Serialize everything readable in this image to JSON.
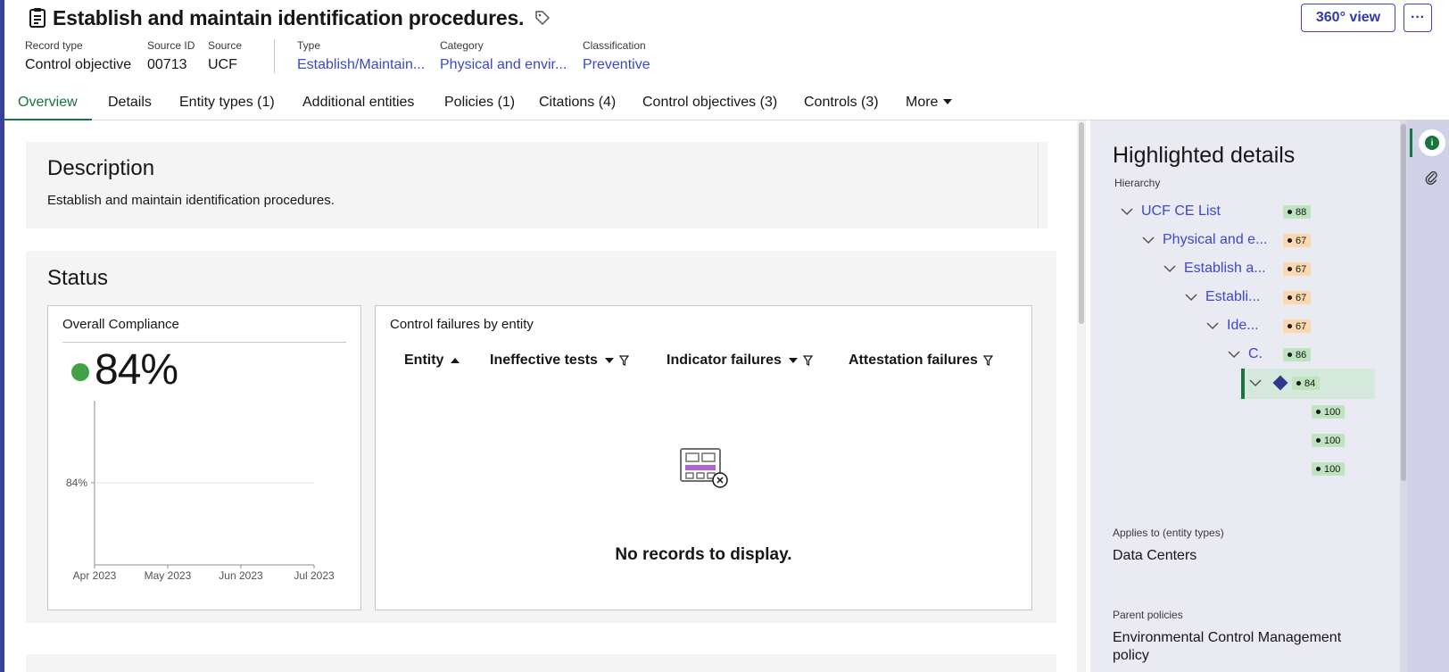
{
  "header": {
    "title": "Establish and maintain identification procedures.",
    "view_360_label": "360° view",
    "overflow_label": "···"
  },
  "meta": {
    "record_type_label": "Record type",
    "record_type_value": "Control objective",
    "source_id_label": "Source ID",
    "source_id_value": "00713",
    "source_label": "Source",
    "source_value": "UCF",
    "type_label": "Type",
    "type_value": "Establish/Maintain...",
    "category_label": "Category",
    "category_value": "Physical and envir...",
    "classification_label": "Classification",
    "classification_value": "Preventive"
  },
  "tabs": [
    {
      "label": "Overview",
      "active": true
    },
    {
      "label": "Details"
    },
    {
      "label": "Entity types (1)"
    },
    {
      "label": "Additional entities"
    },
    {
      "label": "Policies (1)"
    },
    {
      "label": "Citations (4)"
    },
    {
      "label": "Control objectives (3)"
    },
    {
      "label": "Controls (3)"
    },
    {
      "label": "More"
    }
  ],
  "description": {
    "title": "Description",
    "text": "Establish and maintain identification procedures."
  },
  "status": {
    "title": "Status",
    "compliance": {
      "title": "Overall Compliance",
      "value": "84%",
      "status_color": "#42a046"
    },
    "failures": {
      "title": "Control failures by entity",
      "columns": [
        "Entity",
        "Ineffective tests",
        "Indicator failures",
        "Attestation failures"
      ],
      "empty_text": "No records to display."
    }
  },
  "chart_data": {
    "type": "line",
    "title": "",
    "x": [
      "Apr 2023",
      "May 2023",
      "Jun 2023",
      "Jul 2023"
    ],
    "yticks": [
      "84%"
    ],
    "series": [
      {
        "values": [
          84,
          84,
          84,
          84
        ]
      }
    ],
    "xlabel": "",
    "ylabel": ""
  },
  "side_panel": {
    "title": "Highlighted details",
    "hierarchy_label": "Hierarchy",
    "tree": [
      {
        "label": "UCF CE List",
        "badge": "88",
        "badge_color": "green"
      },
      {
        "label": "Physical and e...",
        "badge": "67",
        "badge_color": "orange"
      },
      {
        "label": "Establish a...",
        "badge": "67",
        "badge_color": "orange"
      },
      {
        "label": "Establi...",
        "badge": "67",
        "badge_color": "orange"
      },
      {
        "label": "Ide...",
        "badge": "67",
        "badge_color": "orange"
      },
      {
        "label": "C.",
        "badge": "86",
        "badge_color": "green"
      },
      {
        "label": "",
        "badge": "84",
        "badge_color": "green",
        "selected": true
      },
      {
        "label": "",
        "badge": "100",
        "badge_color": "green"
      },
      {
        "label": "",
        "badge": "100",
        "badge_color": "green"
      },
      {
        "label": "",
        "badge": "100",
        "badge_color": "green"
      }
    ],
    "applies_to_label": "Applies to (entity types)",
    "applies_to_value": "Data Centers",
    "parent_policies_label": "Parent policies",
    "parent_policies_value": "Environmental Control Management policy"
  },
  "icons": {
    "record": "clipboard-icon",
    "tag": "tag-icon",
    "info": "info-icon",
    "attachment": "paperclip-icon",
    "empty_state": "empty-table-icon"
  },
  "colors": {
    "accent": "#3d47c9",
    "active_tab": "#19753f",
    "compliance_green": "#42a046"
  }
}
